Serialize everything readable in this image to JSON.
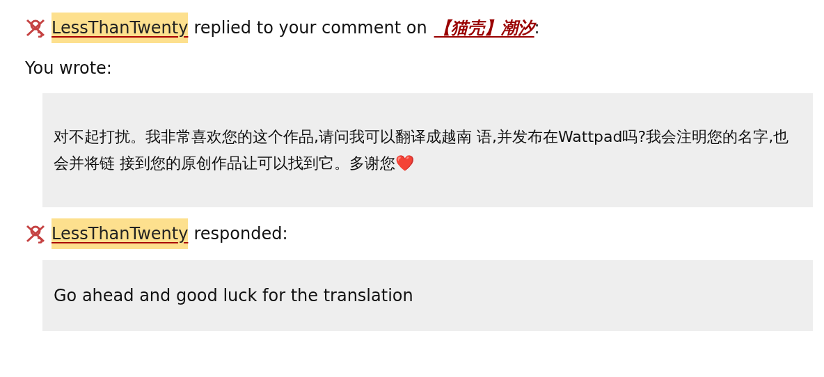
{
  "notification": {
    "username": "LessThanTwenty",
    "action": "replied to your comment on",
    "work_title": "【猫壳】潮汐",
    "punctuation": ":"
  },
  "you_wrote": {
    "label": "You wrote:",
    "comment": "对不起打扰。我非常喜欢您的这个作品,请问我可以翻译成越南 语,并发布在Wattpad吗?我会注明您的名字,也会并将链 接到您的原创作品让可以找到它。多谢您❤️"
  },
  "response": {
    "username": "LessThanTwenty",
    "action": "responded:",
    "comment": "Go ahead and good luck for the translation"
  }
}
